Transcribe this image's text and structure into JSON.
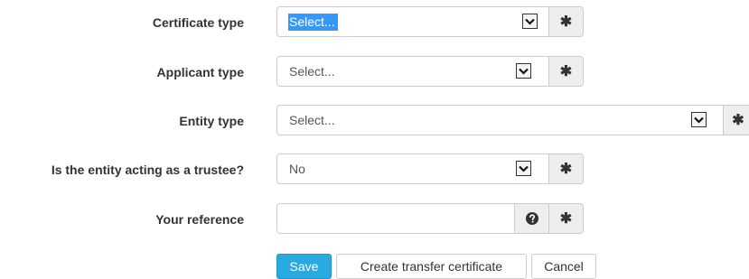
{
  "form": {
    "certificate_type": {
      "label": "Certificate type",
      "value": "Select..."
    },
    "applicant_type": {
      "label": "Applicant type",
      "value": "Select..."
    },
    "entity_type": {
      "label": "Entity type",
      "value": "Select..."
    },
    "trustee": {
      "label": "Is the entity acting as a trustee?",
      "value": "No"
    },
    "reference": {
      "label": "Your reference",
      "value": "",
      "placeholder": ""
    }
  },
  "buttons": {
    "save": "Save",
    "create_transfer": "Create transfer certificate",
    "cancel": "Cancel"
  },
  "icons": {
    "dropdown": "chevron-down-icon",
    "required": "asterisk-icon",
    "help": "question-circle-icon"
  },
  "colors": {
    "primary_button": "#29a9e0",
    "selection_highlight": "#3399ff",
    "addon_background": "#eeeeee"
  }
}
